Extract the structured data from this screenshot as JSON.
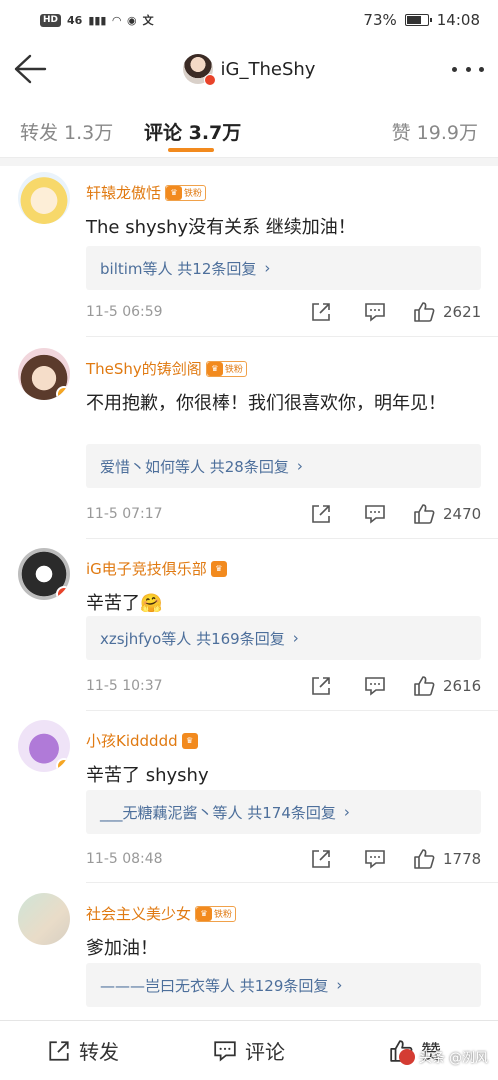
{
  "status_bar": {
    "tags": [
      "HD",
      "46"
    ],
    "battery_percent": "73%",
    "battery_level": 0.73,
    "time": "14:08",
    "extra_icons": [
      "signal-icon",
      "wifi-icon",
      "game-icon",
      "translate-icon"
    ]
  },
  "header": {
    "username": "iG_TheShy",
    "back_icon": "arrow-left-icon",
    "more_icon": "more-dots-icon"
  },
  "tabs": [
    {
      "label": "转发 1.3万",
      "active": false
    },
    {
      "label": "评论 3.7万",
      "active": true
    },
    {
      "label": "赞 19.9万",
      "active": false
    }
  ],
  "accent_color": "#f28a1e",
  "name_color": "#e07a12",
  "link_color": "#4d6f9b",
  "comments": [
    {
      "name": "轩辕龙傲恬",
      "badge": "铁粉",
      "text": "The shyshy没有关系 继续加油！",
      "replies": "biltim等人 共12条回复",
      "time": "11-5 06:59",
      "likes": "2621"
    },
    {
      "name": "TheShy的铸剑阁",
      "badge": "铁粉",
      "text": "不用抱歉，你很棒！我们很喜欢你，明年见！",
      "replies": "爱惜丶如何等人 共28条回复",
      "time": "11-5 07:17",
      "likes": "2470"
    },
    {
      "name": "iG电子竞技俱乐部",
      "badge": "",
      "text": "辛苦了🤗",
      "replies": "xzsjhfyo等人 共169条回复",
      "time": "11-5 10:37",
      "likes": "2616"
    },
    {
      "name": "小孩Kiddddd",
      "badge": "",
      "text": "辛苦了 shyshy",
      "replies": "___无糖藕泥酱丶等人 共174条回复",
      "time": "11-5 08:48",
      "likes": "1778"
    },
    {
      "name": "社会主义美少女",
      "badge": "铁粉",
      "text": "爹加油！",
      "replies": "———岂曰无衣等人 共129条回复",
      "time": "",
      "likes": ""
    }
  ],
  "bottom_bar": {
    "repost": "转发",
    "comment": "评论",
    "like": "赞"
  },
  "watermark": "头条 @洌风"
}
